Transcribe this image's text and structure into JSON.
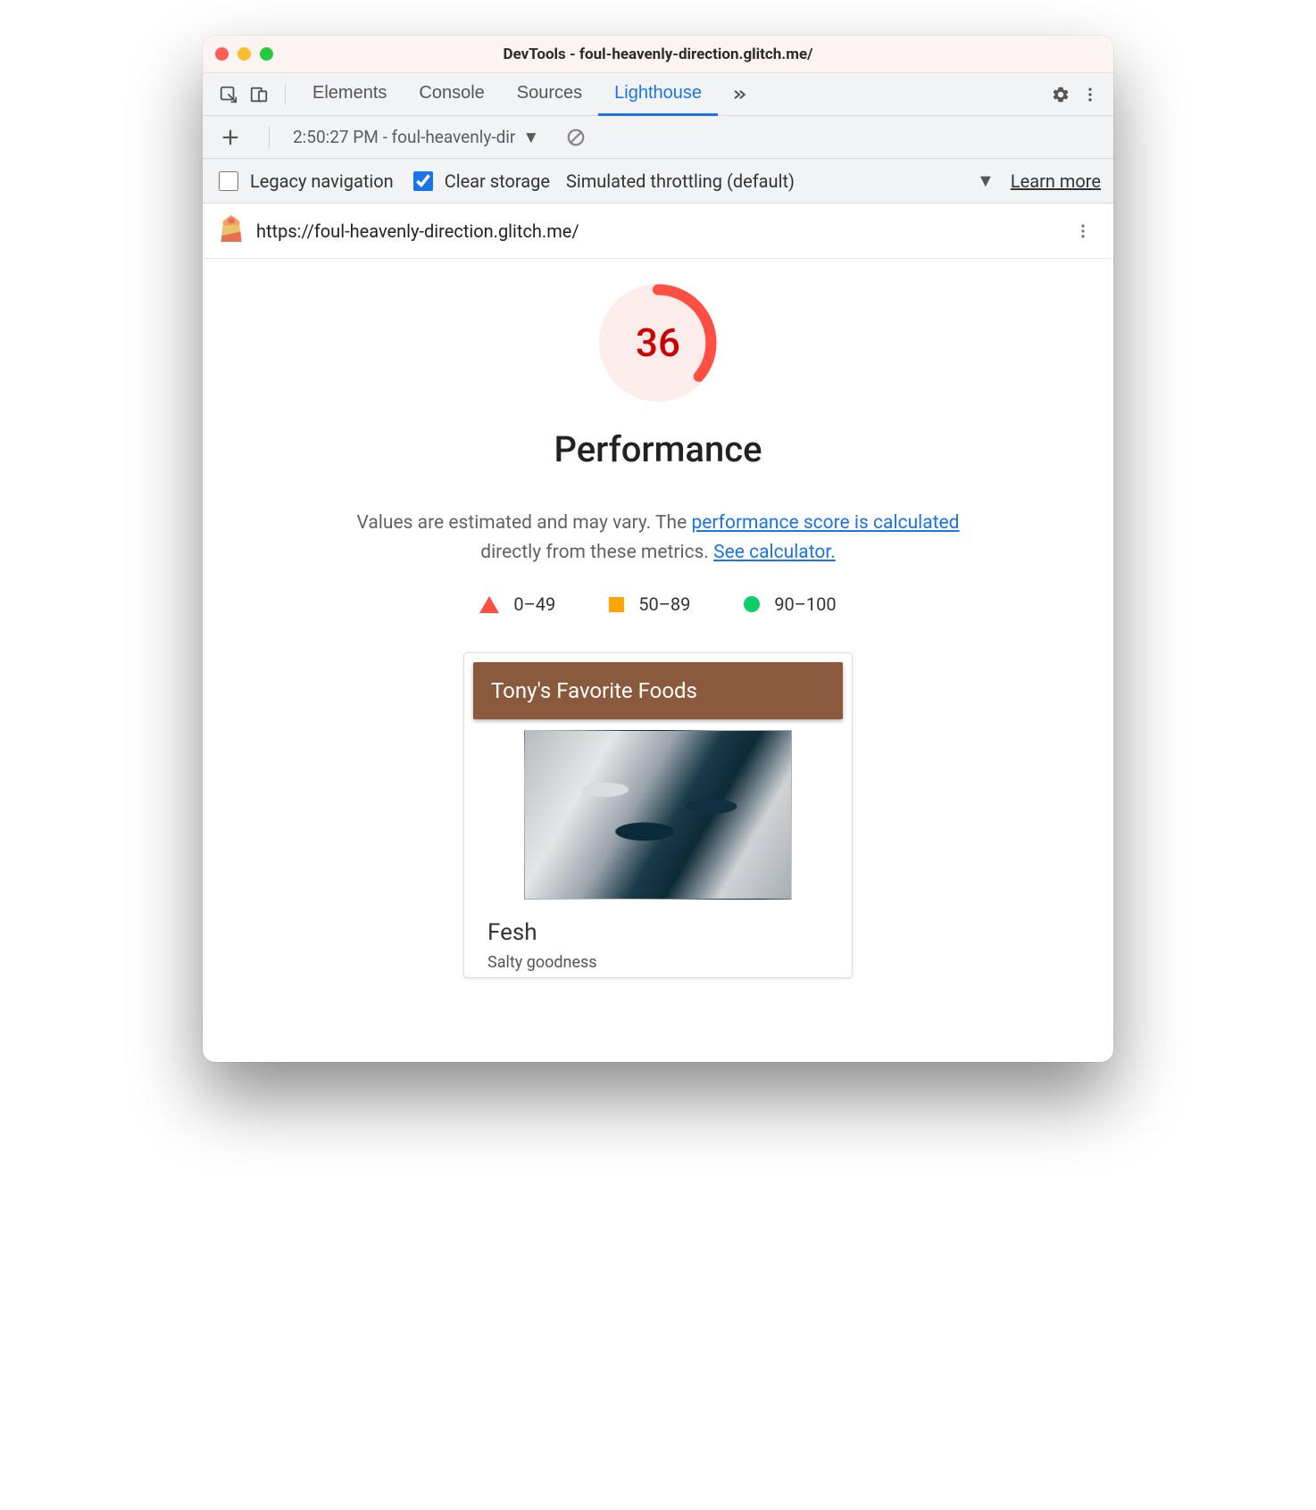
{
  "window": {
    "title": "DevTools - foul-heavenly-direction.glitch.me/"
  },
  "tabs": {
    "items": [
      "Elements",
      "Console",
      "Sources",
      "Lighthouse"
    ],
    "active_index": 3
  },
  "subbar": {
    "report_label": "2:50:27 PM - foul-heavenly-dir"
  },
  "options": {
    "legacy_label": "Legacy navigation",
    "legacy_checked": false,
    "clear_label": "Clear storage",
    "clear_checked": true,
    "throttling_label": "Simulated throttling (default)",
    "learn_more": "Learn more"
  },
  "urlrow": {
    "url": "https://foul-heavenly-direction.glitch.me/"
  },
  "score": {
    "value": "36",
    "title": "Performance",
    "percent": 36,
    "color_bad": "#ff4e42",
    "desc_prefix": "Values are estimated and may vary. The ",
    "link1": "performance score is calculated",
    "desc_mid": " directly from these metrics. ",
    "link2": "See calculator."
  },
  "legend": {
    "bad": "0–49",
    "avg": "50–89",
    "good": "90–100"
  },
  "preview": {
    "card_title": "Tony's Favorite Foods",
    "item_name": "Fesh",
    "item_sub": "Salty goodness"
  }
}
